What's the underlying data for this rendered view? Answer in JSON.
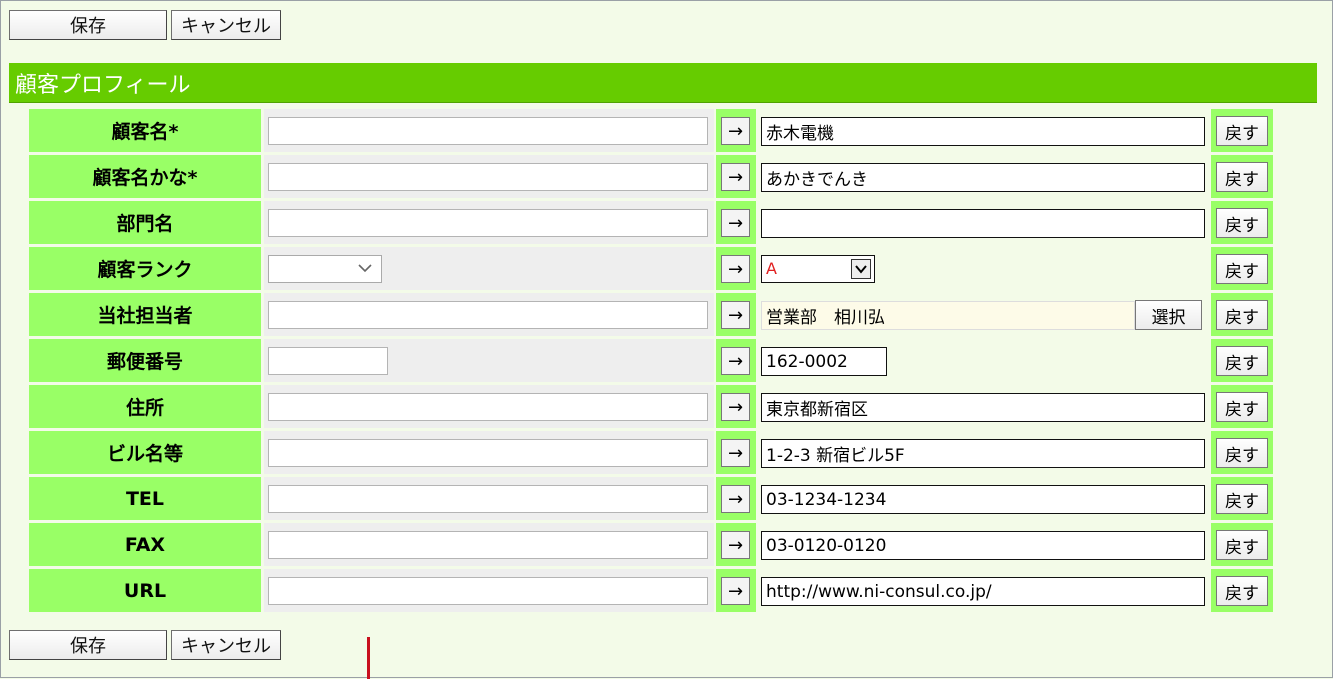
{
  "toolbar": {
    "save_label": "保存",
    "cancel_label": "キャンセル"
  },
  "section": {
    "title": "顧客プロフィール"
  },
  "arrow_label": "→",
  "back_label": "戻す",
  "select_button_label": "選択",
  "rows": [
    {
      "label": "顧客名*",
      "value": "赤木電機"
    },
    {
      "label": "顧客名かな*",
      "value": "あかきでんき"
    },
    {
      "label": "部門名",
      "value": ""
    },
    {
      "label": "顧客ランク",
      "value": "A"
    },
    {
      "label": "当社担当者",
      "value": "営業部　相川弘"
    },
    {
      "label": "郵便番号",
      "value": "162-0002"
    },
    {
      "label": "住所",
      "value": "東京都新宿区"
    },
    {
      "label": "ビル名等",
      "value": "1-2-3 新宿ビル5F"
    },
    {
      "label": "TEL",
      "value": "03-1234-1234"
    },
    {
      "label": "FAX",
      "value": "03-0120-0120"
    },
    {
      "label": "URL",
      "value": "http://www.ni-consul.co.jp/"
    }
  ],
  "colors": {
    "header": "#66cc00",
    "label_bg": "#99ff66",
    "rank_value": "#e02020"
  }
}
